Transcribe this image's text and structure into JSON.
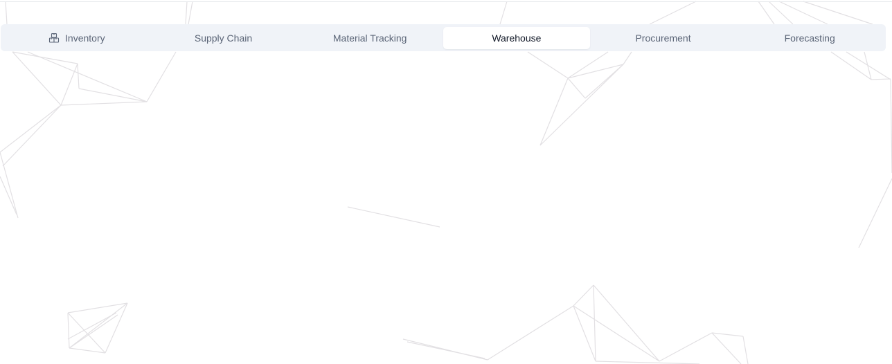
{
  "tabs": [
    {
      "id": "inventory",
      "label": "Inventory",
      "icon": "boxes-icon",
      "active": false
    },
    {
      "id": "supply-chain",
      "label": "Supply Chain",
      "active": false
    },
    {
      "id": "material-tracking",
      "label": "Material Tracking",
      "active": false
    },
    {
      "id": "warehouse",
      "label": "Warehouse",
      "active": true
    },
    {
      "id": "procurement",
      "label": "Procurement",
      "active": false
    },
    {
      "id": "forecasting",
      "label": "Forecasting",
      "active": false
    }
  ],
  "colors": {
    "tabbar_background": "#f0f3f8",
    "active_tab_background": "#ffffff",
    "tab_text": "#5b6577",
    "active_tab_text": "#111827",
    "background_lines": "#e2e0e3"
  }
}
